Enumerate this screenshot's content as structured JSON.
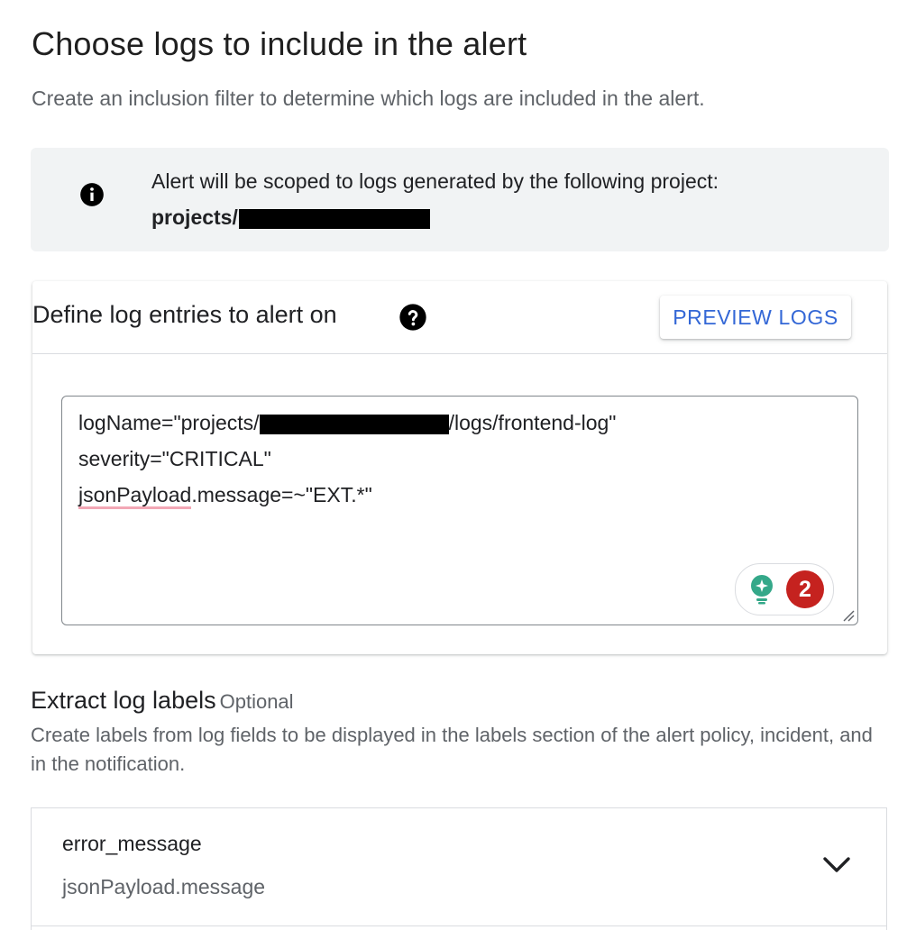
{
  "page": {
    "title": "Choose logs to include in the alert",
    "subtitle": "Create an inclusion filter to determine which logs are included in the alert."
  },
  "info_banner": {
    "icon": "info-icon",
    "text": "Alert will be scoped to logs generated by the following project:",
    "project_prefix": "projects/"
  },
  "query_card": {
    "title": "Define log entries to alert on",
    "help_icon": "help-icon",
    "preview_button_label": "PREVIEW LOGS",
    "editor": {
      "line1_prefix": "logName=\"projects/",
      "line1_suffix": "/logs/frontend-log\"",
      "line2": "severity=\"CRITICAL\"",
      "line3_token": "jsonPayload",
      "line3_rest": ".message=~\"EXT.*\""
    },
    "lint": {
      "icon": "lightbulb-icon",
      "error_count": "2",
      "error_color": "#c5221f",
      "bulb_color": "#34a889"
    }
  },
  "labels_section": {
    "title": "Extract log labels",
    "optional": "Optional",
    "description": "Create labels from log fields to be displayed in the labels section of the alert policy, incident, and in the notification.",
    "items": [
      {
        "name": "error_message",
        "field": "jsonPayload.message",
        "icon": "chevron-down-icon"
      }
    ]
  },
  "colors": {
    "accent": "#3367d6",
    "banner_bg": "#f1f3f4",
    "squiggle": "#f2a7b5"
  }
}
